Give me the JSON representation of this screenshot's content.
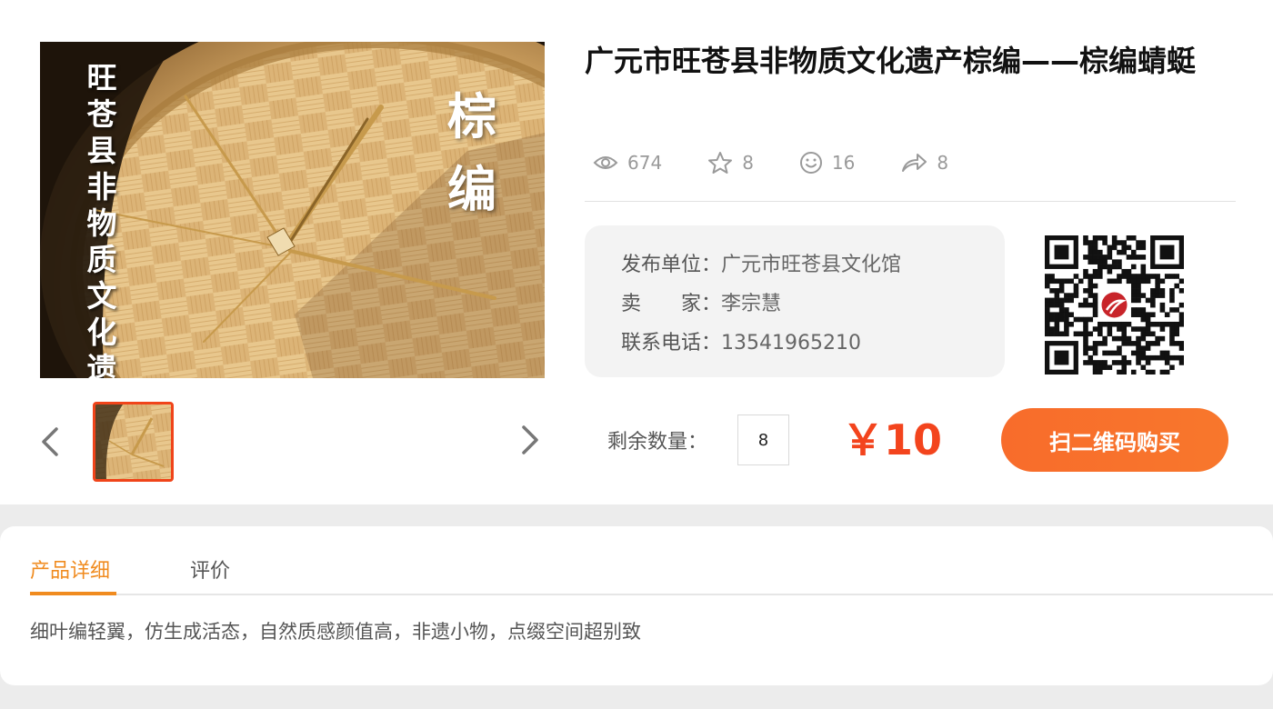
{
  "product": {
    "title": "广元市旺苍县非物质文化遗产棕编——棕编蜻蜓",
    "image_overlay_vertical": "旺苍县非物质文化遗产",
    "image_overlay_corner": "棕编"
  },
  "stats": {
    "views": "674",
    "favorites": "8",
    "likes": "16",
    "shares": "8"
  },
  "info": {
    "publisher_label": "发布单位：",
    "publisher_value": "广元市旺苍县文化馆",
    "seller_label": "卖　　家：",
    "seller_value": "李宗慧",
    "phone_label": "联系电话：",
    "phone_value": "13541965210"
  },
  "purchase": {
    "quantity_label": "剩余数量：",
    "quantity_value": "8",
    "price": "￥10",
    "buy_button_label": "扫二维码购买"
  },
  "tabs": [
    {
      "label": "产品详细",
      "active": true
    },
    {
      "label": "评价",
      "active": false
    }
  ],
  "description": "细叶编轻翼，仿生成活态，自然质感颜值高，非遗小物，点缀空间超别致",
  "colors": {
    "accent_orange": "#f08b1f",
    "price_red": "#f3441d",
    "button_orange": "#f8722c"
  },
  "icons": [
    "eye-icon",
    "star-icon",
    "smiley-icon",
    "share-icon",
    "chevron-left-icon",
    "chevron-right-icon",
    "qr-code-icon"
  ]
}
